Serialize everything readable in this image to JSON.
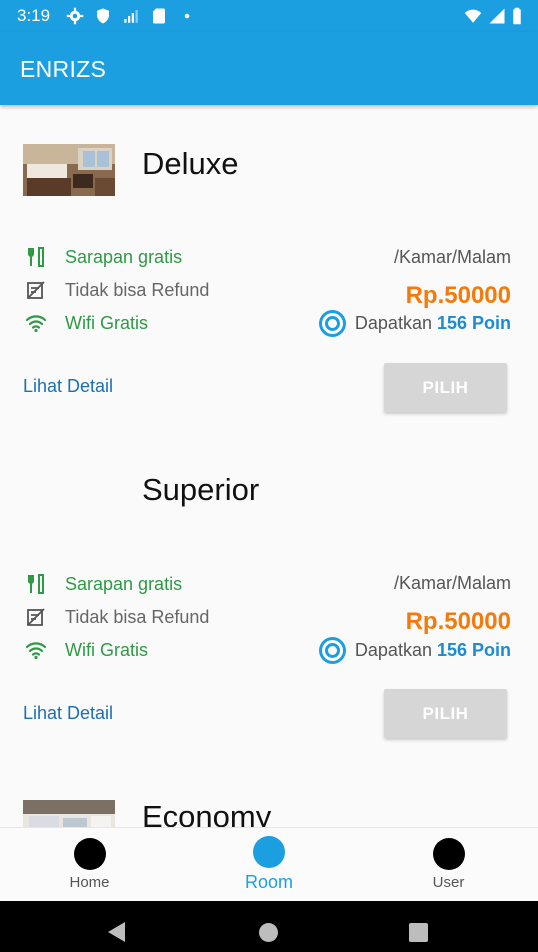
{
  "status_bar": {
    "time": "3:19",
    "left_icons": [
      "gear-icon",
      "shield-icon",
      "no-signal-icon",
      "sd-card-icon",
      "dot-icon"
    ],
    "right_icons": [
      "wifi-icon",
      "signal-icon",
      "battery-icon"
    ]
  },
  "app_bar": {
    "title": "ENRIZS"
  },
  "colors": {
    "primary": "#1b9fe0",
    "price": "#f47a0c",
    "feature_green": "#2e9a45",
    "button_disabled": "#d6d6d6"
  },
  "rooms": [
    {
      "name": "Deluxe",
      "has_image": true,
      "features": [
        {
          "icon": "fork-knife-icon",
          "label": "Sarapan gratis",
          "style": "green"
        },
        {
          "icon": "no-refund-icon",
          "label": "Tidak bisa Refund",
          "style": "grey"
        },
        {
          "icon": "wifi-icon",
          "label": "Wifi Gratis",
          "style": "green"
        }
      ],
      "per_night": "/Kamar/Malam",
      "price": "Rp.50000",
      "poin_prefix": "Dapatkan",
      "poin_value": "156 Poin",
      "detail_link": "Lihat Detail",
      "select_button": "PILIH"
    },
    {
      "name": "Superior",
      "has_image": false,
      "features": [
        {
          "icon": "fork-knife-icon",
          "label": "Sarapan gratis",
          "style": "green"
        },
        {
          "icon": "no-refund-icon",
          "label": "Tidak bisa Refund",
          "style": "grey"
        },
        {
          "icon": "wifi-icon",
          "label": "Wifi Gratis",
          "style": "green"
        }
      ],
      "per_night": "/Kamar/Malam",
      "price": "Rp.50000",
      "poin_prefix": "Dapatkan",
      "poin_value": "156 Poin",
      "detail_link": "Lihat Detail",
      "select_button": "PILIH"
    },
    {
      "name": "Economy",
      "has_image": true
    }
  ],
  "bottom_nav": {
    "items": [
      {
        "label": "Home",
        "active": false
      },
      {
        "label": "Room",
        "active": true
      },
      {
        "label": "User",
        "active": false
      }
    ]
  }
}
